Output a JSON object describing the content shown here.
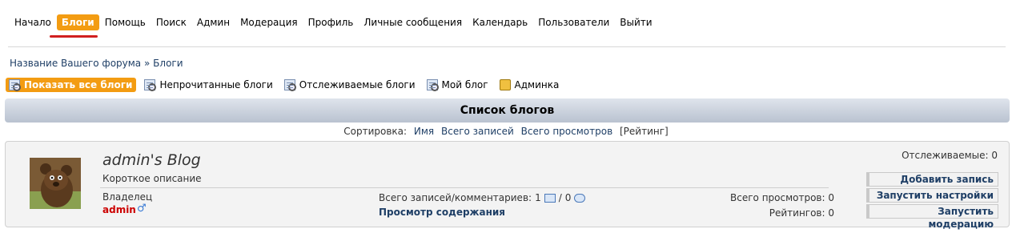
{
  "nav": {
    "items": [
      "Начало",
      "Блоги",
      "Помощь",
      "Поиск",
      "Админ",
      "Модерация",
      "Профиль",
      "Личные сообщения",
      "Календарь",
      "Пользователи",
      "Выйти"
    ],
    "active_index": 1
  },
  "breadcrumb": {
    "forum": "Название Вашего форума",
    "separator": "»",
    "current": "Блоги"
  },
  "toolbar": {
    "show_all": "Показать все блоги",
    "unread": "Непрочитанные блоги",
    "watched": "Отслеживаемые блоги",
    "my_blog": "Мой блог",
    "admin": "Админка"
  },
  "list": {
    "title": "Список блогов",
    "sort_label": "Сортировка:",
    "sort_name": "Имя",
    "sort_total_posts": "Всего записей",
    "sort_total_views": "Всего просмотров",
    "sort_rating": "[Рейтинг]"
  },
  "blog": {
    "title": "admin's Blog",
    "description": "Короткое описание",
    "owner_label": "Владелец",
    "owner_name": "admin",
    "posts_label": "Всего записей/комментариев:",
    "posts_count": "1",
    "posts_sep": "/",
    "comments_count": "0",
    "view_content": "Просмотр содержания",
    "total_views": "Всего просмотров: 0",
    "ratings": "Рейтингов: 0",
    "watchers": "Отслеживаемые: 0",
    "btn_add": "Добавить запись",
    "btn_settings": "Запустить настройки",
    "btn_moderation": "Запустить модерацию"
  },
  "colors": {
    "accent": "#f39c12",
    "link": "#1f3f66",
    "owner": "#cc0000",
    "underline": "#d11f1f"
  }
}
